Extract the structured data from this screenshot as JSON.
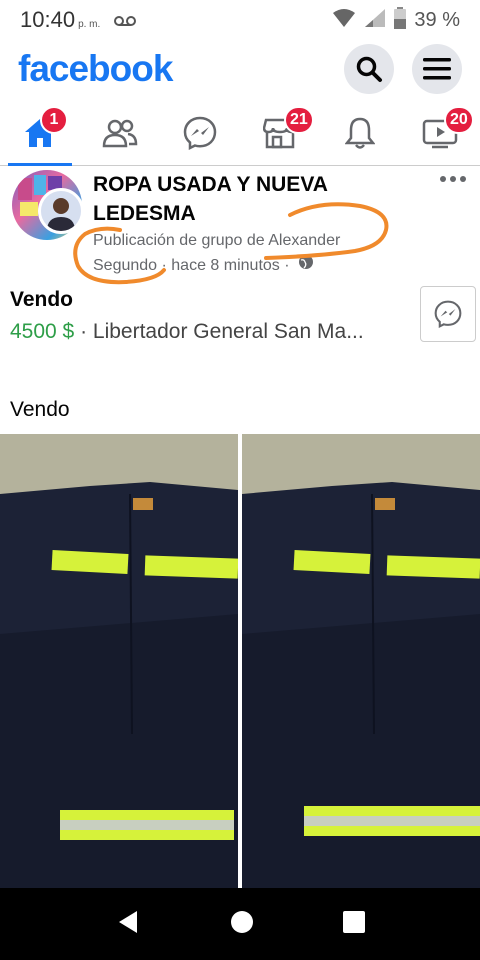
{
  "status_bar": {
    "time": "10:40",
    "ampm": "p. m.",
    "battery": "39 %"
  },
  "header": {
    "logo": "facebook",
    "search_icon": "search-icon",
    "menu_icon": "menu-icon"
  },
  "nav": {
    "home_badge": "1",
    "marketplace_badge": "21",
    "watch_badge": "20"
  },
  "post": {
    "group_name": "ROPA USADA Y NUEVA LEDESMA",
    "meta_line1": "Publicación de grupo de Alexander",
    "meta_line2": "Segundo · hace 8 minutos ·",
    "listing_title": "Vendo",
    "price": "4500 $",
    "location": "· Libertador General San Ma...",
    "text": "Vendo"
  },
  "colors": {
    "brand": "#1877f2",
    "badge": "#e41e3f",
    "price": "#2e9e48",
    "scribble": "#f08a2c"
  }
}
